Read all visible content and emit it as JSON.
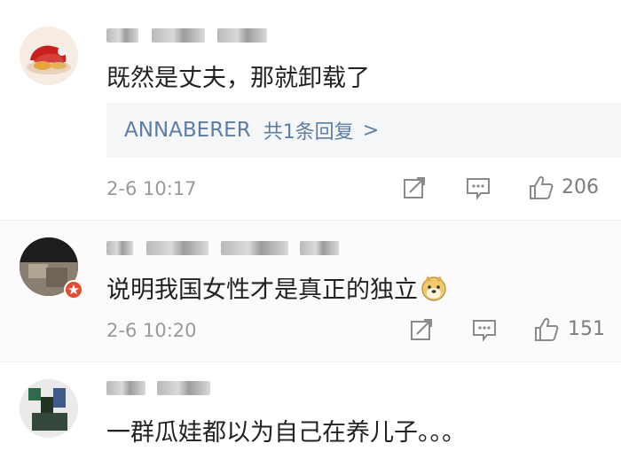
{
  "comments": [
    {
      "username": "■ ■ ■ ■ ■ ■",
      "text": "既然是丈夫，那就卸载了",
      "reply_user": "ANNABERER",
      "reply_count": "共1条回复",
      "reply_arrow": ">",
      "time": "2-6 10:17",
      "likes": "206",
      "avatar_icon": "dessert-avatar"
    },
    {
      "username": "■ ■ ■ ■ ■ ■",
      "text": "说明我国女性才是真正的独立",
      "emoji": "doge-emoji",
      "time": "2-6 10:20",
      "likes": "151",
      "avatar_icon": "photo-avatar"
    },
    {
      "username": "■ ■ ■ ■",
      "text": "一群瓜娃都以为自己在养儿子。。。",
      "avatar_icon": "photo-avatar"
    }
  ],
  "icons": [
    "repost-icon",
    "comment-icon",
    "like-icon"
  ],
  "colors": {
    "link": "#5c7ea6",
    "meta": "#9a9a9a",
    "text": "#222222",
    "reply_bg": "#f5f6f8"
  }
}
